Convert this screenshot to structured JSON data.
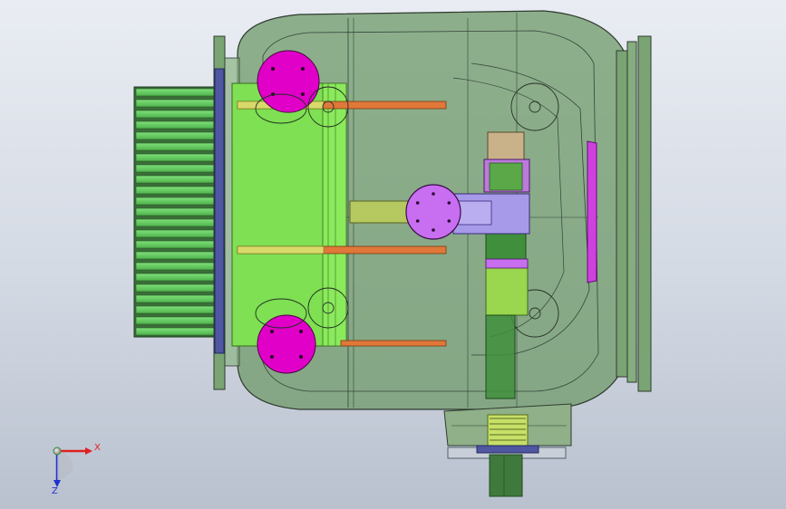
{
  "viewport": {
    "background_top": "#e9edf3",
    "background_bottom": "#b9c1cf"
  },
  "colors": {
    "housing": "#6f9a68",
    "housing_edge": "#2f3b2f",
    "fin_green": "#66d060",
    "block_green": "#7ee052",
    "flange_blue": "#4f57a0",
    "magenta": "#e000c8",
    "violet": "#c86ef0",
    "lavender": "#a79ae8",
    "orange_bar": "#e0783a",
    "olive": "#b6c860",
    "tan": "#c9b28a",
    "shaft_green": "#3f8f3c",
    "axis_x": "#e02020",
    "axis_y": "#20a020",
    "axis_z": "#2030d0"
  },
  "triad": {
    "x_label": "X",
    "z_label": "Z"
  },
  "icons": [
    "coordinate-triad-icon"
  ]
}
